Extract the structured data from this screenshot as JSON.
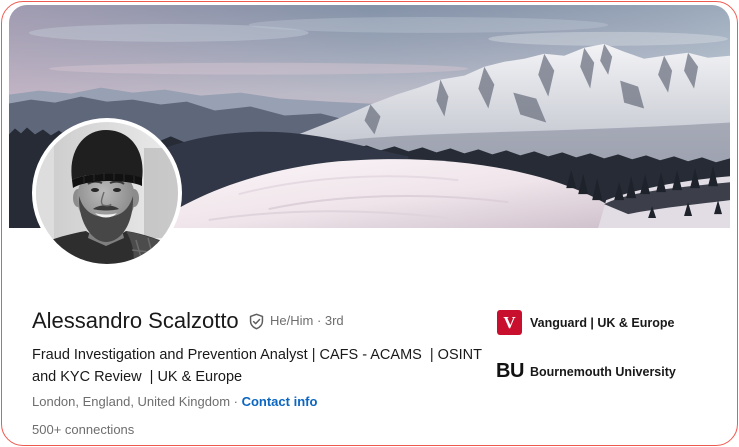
{
  "profile": {
    "name": "Alessandro Scalzotto",
    "pronouns": "He/Him",
    "degree_separator": "·",
    "connection_degree": "3rd",
    "headline": "Fraud Investigation and Prevention Analyst | CAFS - ACAMS  | OSINT and KYC Review  | UK & Europe",
    "location": "London, England, United Kingdom",
    "location_separator": "·",
    "contact_info_label": "Contact info",
    "connections": "500+ connections"
  },
  "highlights": [
    {
      "logo_text": "V",
      "label": "Vanguard | UK & Europe"
    },
    {
      "logo_text": "BU",
      "label": "Bournemouth University"
    }
  ],
  "icons": {
    "verified_badge": "verified-shield-icon",
    "vanguard_logo": "vanguard-logo",
    "bournemouth_logo": "bournemouth-university-logo"
  },
  "colors": {
    "card_border": "#ef5a50",
    "text_primary": "#191919",
    "text_secondary": "#6e6e6e",
    "link": "#0a66c2",
    "vanguard_red": "#c8102e",
    "bu_black": "#111111"
  }
}
